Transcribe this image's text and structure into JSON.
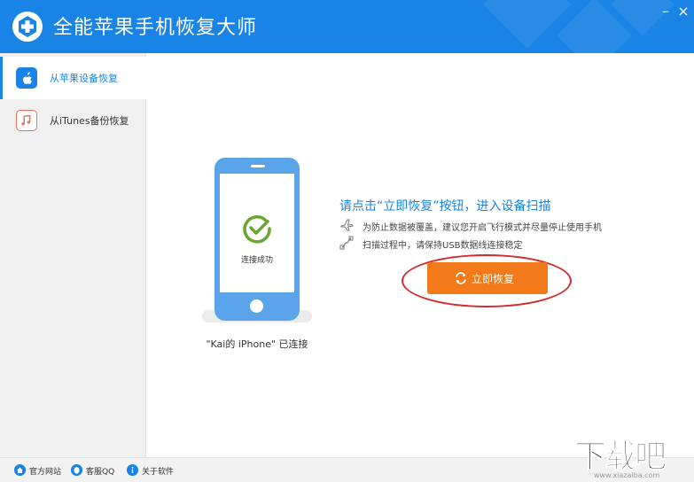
{
  "app": {
    "title": "全能苹果手机恢复大师",
    "minimize_label": "–",
    "close_label": "×"
  },
  "sidebar": {
    "items": [
      {
        "label": "从苹果设备恢复",
        "icon": "apple-icon",
        "active": true
      },
      {
        "label": "从iTunes备份恢复",
        "icon": "music-note-icon",
        "active": false
      }
    ]
  },
  "device": {
    "connect_status": "连接成功",
    "connected_text": "\"Kai的 iPhone\" 已连接"
  },
  "instructions": {
    "title": "请点击“立即恢复”按钮，进入设备扫描",
    "tips": [
      {
        "icon": "airplane-icon",
        "text": "为防止数据被覆盖，建议您开启飞行模式并尽量停止使用手机"
      },
      {
        "icon": "usb-cable-icon",
        "text": "扫描过程中，请保持USB数据线连接稳定"
      }
    ]
  },
  "recover_button": {
    "label": "立即恢复",
    "icon": "refresh-icon"
  },
  "footer": {
    "links": [
      {
        "label": "官方网站",
        "icon": "home-icon"
      },
      {
        "label": "客服QQ",
        "icon": "qq-icon"
      },
      {
        "label": "关于软件",
        "icon": "info-icon"
      }
    ]
  },
  "watermark": {
    "main": "下载吧",
    "url": "www.xiazaiba.com"
  },
  "colors": {
    "accent": "#1a84e6",
    "button": "#f27a1a",
    "highlight_ring": "#d42a2a",
    "success": "#6aa632"
  }
}
